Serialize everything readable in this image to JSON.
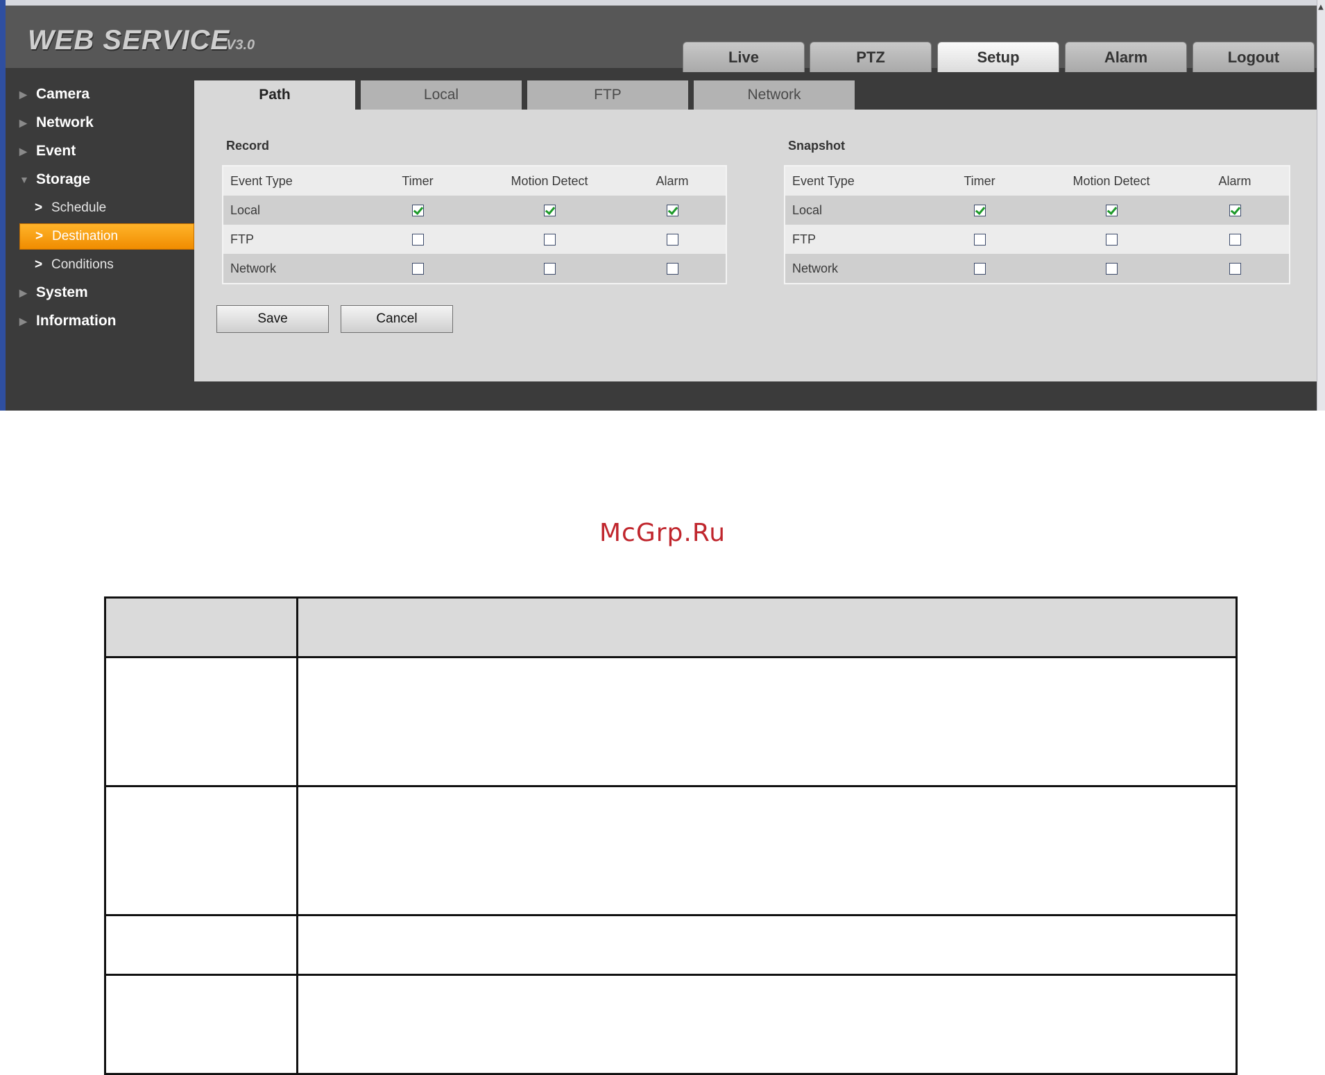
{
  "app": {
    "logo_text": "WEB  SERVICE",
    "logo_version": "V3.0",
    "top_tabs": [
      {
        "label": "Live"
      },
      {
        "label": "PTZ"
      },
      {
        "label": "Setup",
        "active": true
      },
      {
        "label": "Alarm"
      },
      {
        "label": "Logout"
      }
    ]
  },
  "sidebar": {
    "items": [
      {
        "label": "Camera"
      },
      {
        "label": "Network"
      },
      {
        "label": "Event"
      },
      {
        "label": "Storage",
        "expanded": true
      },
      {
        "label": "System"
      },
      {
        "label": "Information"
      }
    ],
    "storage_sub": [
      {
        "label": "Schedule"
      },
      {
        "label": "Destination",
        "active": true
      },
      {
        "label": "Conditions"
      }
    ],
    "active_color": "#f39a00"
  },
  "content": {
    "tabs": [
      {
        "label": "Path",
        "active": true
      },
      {
        "label": "Local"
      },
      {
        "label": "FTP"
      },
      {
        "label": "Network"
      }
    ],
    "record": {
      "title": "Record",
      "headers": [
        "Event Type",
        "Timer",
        "Motion Detect",
        "Alarm"
      ],
      "rows": [
        {
          "label": "Local",
          "timer": true,
          "motion": true,
          "alarm": true
        },
        {
          "label": "FTP",
          "timer": false,
          "motion": false,
          "alarm": false
        },
        {
          "label": "Network",
          "timer": false,
          "motion": false,
          "alarm": false
        }
      ]
    },
    "snapshot": {
      "title": "Snapshot",
      "headers": [
        "Event Type",
        "Timer",
        "Motion Detect",
        "Alarm"
      ],
      "rows": [
        {
          "label": "Local",
          "timer": true,
          "motion": true,
          "alarm": true
        },
        {
          "label": "FTP",
          "timer": false,
          "motion": false,
          "alarm": false
        },
        {
          "label": "Network",
          "timer": false,
          "motion": false,
          "alarm": false
        }
      ]
    },
    "save_label": "Save",
    "cancel_label": "Cancel"
  },
  "watermark": "McGrp.Ru"
}
